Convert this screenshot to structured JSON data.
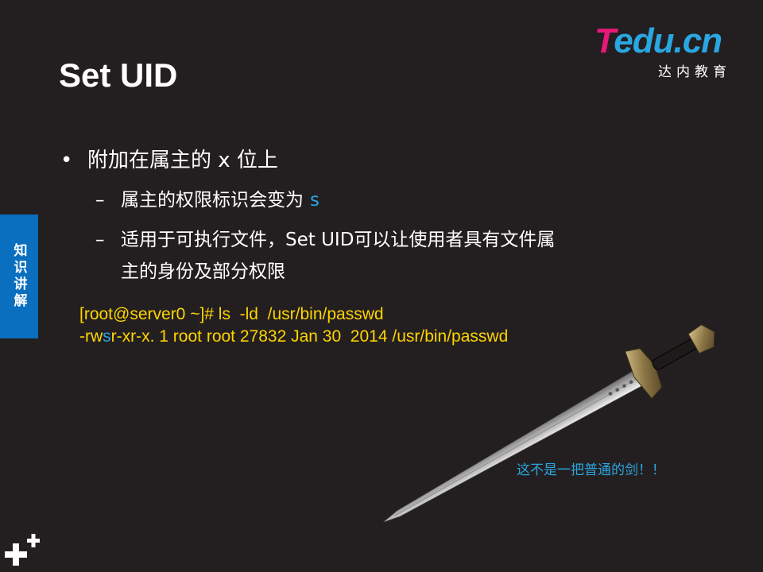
{
  "logo": {
    "brand_t": "T",
    "brand_rest": "edu.cn",
    "subtitle": "达内教育",
    "colors": {
      "pink": "#e8177a",
      "blue": "#2aa6e0"
    }
  },
  "title": "Set UID",
  "side_tab": "知识讲解",
  "bullets": {
    "main": {
      "mark": "•",
      "text": "附加在属主的 x 位上"
    },
    "subs": [
      {
        "dash": "–",
        "text": "属主的权限标识会变为",
        "accent": "s"
      },
      {
        "dash": "–",
        "line1": "适用于可执行文件，Set UID可以让使用者具有文件属",
        "line2": "主的身份及部分权限"
      }
    ]
  },
  "terminal": {
    "line1": "[root@server0 ~]# ls  -ld  /usr/bin/passwd",
    "line2_pre": "-rw",
    "line2_s": "s",
    "line2_post": "r-xr-x. 1 root root 27832 Jan 30  2014 /usr/bin/passwd",
    "colors": {
      "text": "#ffd400",
      "highlight": "#2aa6e0"
    }
  },
  "caption": "这不是一把普通的剑！！",
  "icons": {
    "sword": "sword-illustration",
    "plus": "plus-icon"
  },
  "theme": {
    "background": "#231f20",
    "tab_blue": "#0a6fbf"
  }
}
